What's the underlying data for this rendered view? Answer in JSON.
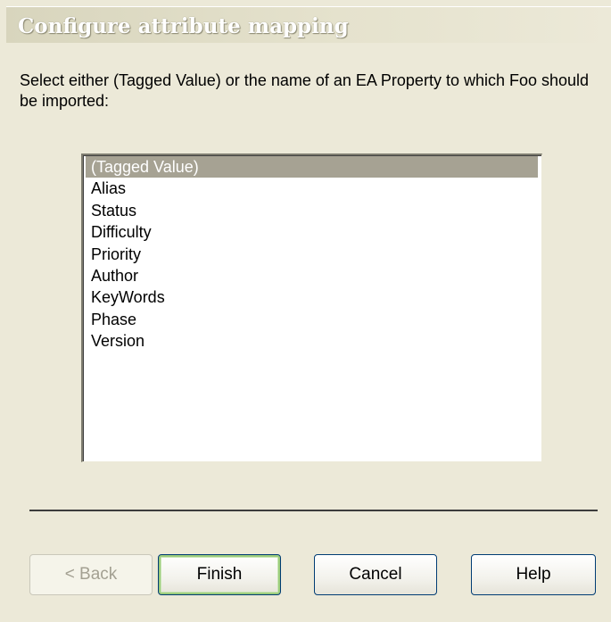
{
  "dialog": {
    "title": "Configure attribute mapping",
    "instruction": "Select either (Tagged Value) or the name of an EA Property to which Foo should be imported:"
  },
  "property_list": {
    "items": [
      {
        "label": "(Tagged Value)",
        "selected": true
      },
      {
        "label": "Alias",
        "selected": false
      },
      {
        "label": "Status",
        "selected": false
      },
      {
        "label": "Difficulty",
        "selected": false
      },
      {
        "label": "Priority",
        "selected": false
      },
      {
        "label": "Author",
        "selected": false
      },
      {
        "label": "KeyWords",
        "selected": false
      },
      {
        "label": "Phase",
        "selected": false
      },
      {
        "label": "Version",
        "selected": false
      }
    ]
  },
  "buttons": {
    "back": {
      "label": "< Back",
      "enabled": false
    },
    "finish": {
      "label": "Finish",
      "enabled": true,
      "default": true
    },
    "cancel": {
      "label": "Cancel",
      "enabled": true
    },
    "help": {
      "label": "Help",
      "enabled": true
    }
  },
  "colors": {
    "dialog_background": "#ece9d8",
    "selection": "#a6a293",
    "button_border": "#003c74"
  }
}
